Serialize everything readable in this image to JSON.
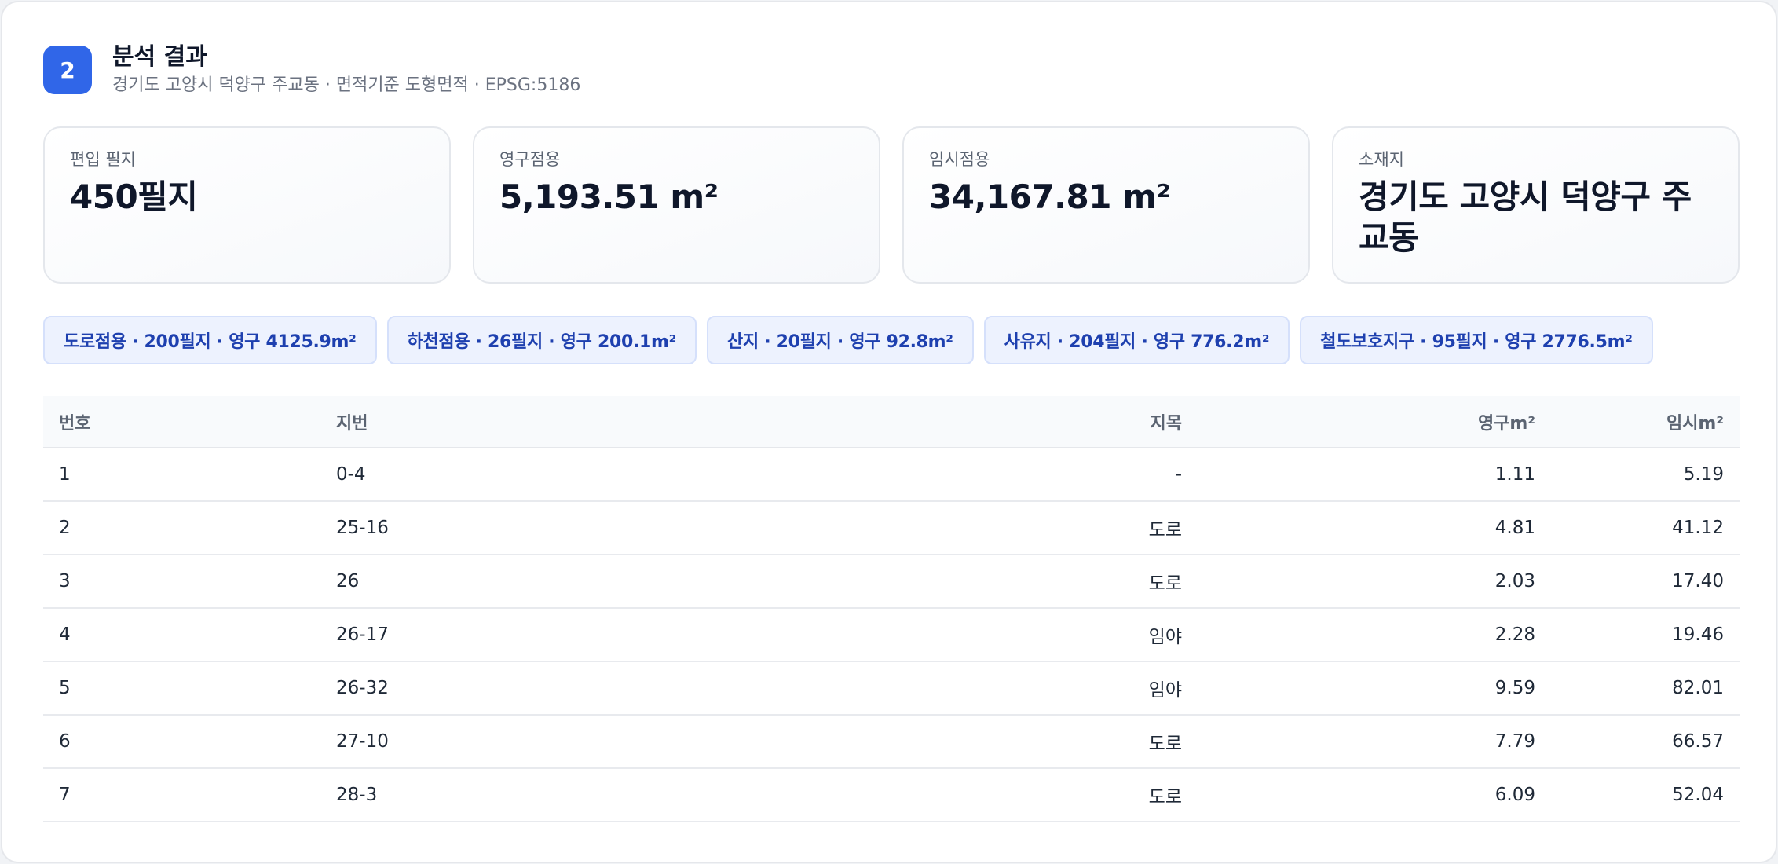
{
  "header": {
    "step": "2",
    "title": "분석 결과",
    "subtitle": "경기도 고양시 덕양구 주교동 · 면적기준 도형면적 · EPSG:5186"
  },
  "cards": [
    {
      "label": "편입 필지",
      "value": "450필지"
    },
    {
      "label": "영구점용",
      "value": "5,193.51 m²"
    },
    {
      "label": "임시점용",
      "value": "34,167.81 m²"
    },
    {
      "label": "소재지",
      "value": "경기도 고양시 덕양구 주교동"
    }
  ],
  "chips": [
    "도로점용 · 200필지 · 영구 4125.9m²",
    "하천점용 · 26필지 · 영구 200.1m²",
    "산지 · 20필지 · 영구 92.8m²",
    "사유지 · 204필지 · 영구 776.2m²",
    "철도보호지구 · 95필지 · 영구 2776.5m²"
  ],
  "table": {
    "headers": [
      "번호",
      "지번",
      "지목",
      "영구m²",
      "임시m²"
    ],
    "rows": [
      [
        "1",
        "0-4",
        "-",
        "1.11",
        "5.19"
      ],
      [
        "2",
        "25-16",
        "도로",
        "4.81",
        "41.12"
      ],
      [
        "3",
        "26",
        "도로",
        "2.03",
        "17.40"
      ],
      [
        "4",
        "26-17",
        "임야",
        "2.28",
        "19.46"
      ],
      [
        "5",
        "26-32",
        "임야",
        "9.59",
        "82.01"
      ],
      [
        "6",
        "27-10",
        "도로",
        "7.79",
        "66.57"
      ],
      [
        "7",
        "28-3",
        "도로",
        "6.09",
        "52.04"
      ]
    ]
  },
  "colors": {
    "accent": "#3066e8",
    "chip_bg": "#edf2fe",
    "chip_text": "#1e40af"
  }
}
